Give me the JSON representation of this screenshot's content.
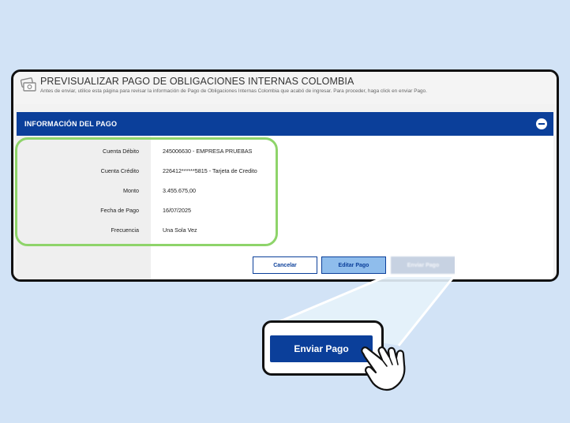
{
  "page": {
    "title": "PREVISUALIZAR PAGO DE OBLIGACIONES INTERNAS COLOMBIA",
    "subtitle": "Antes de enviar, utilice esta página para revisar la información de Pago de Obligaciones Internas Colombia que acabó de ingresar. Para proceder, haga click en enviar Pago."
  },
  "section": {
    "title": "INFORMACIÓN DEL PAGO",
    "collapse_icon": "minus-circle-icon"
  },
  "details": [
    {
      "label": "Cuenta Débito",
      "value": "245006630 - EMPRESA PRUEBAS"
    },
    {
      "label": "Cuenta Crédito",
      "value": "226412******5815 - Tarjeta de Credito"
    },
    {
      "label": "Monto",
      "value": "3.455.675,00"
    },
    {
      "label": "Fecha de Pago",
      "value": "16/07/2025"
    },
    {
      "label": "Frecuencia",
      "value": "Una Sola Vez"
    }
  ],
  "buttons": {
    "cancel": "Cancelar",
    "edit": "Editar Pago",
    "send": "Enviar Pago"
  },
  "callout": {
    "send_label": "Enviar Pago"
  },
  "colors": {
    "primary": "#0b3f9a",
    "highlight": "#8ed46a",
    "background": "#d2e3f6",
    "edit_button": "#8fbdec"
  }
}
